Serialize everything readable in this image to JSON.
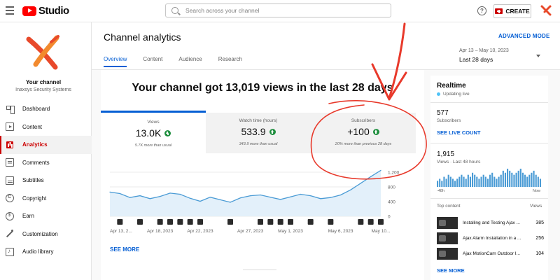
{
  "header": {
    "logo_text": "Studio",
    "search_placeholder": "Search across your channel",
    "help_icon": "?",
    "create_label": "CREATE"
  },
  "sidebar": {
    "channel_title": "Your channel",
    "channel_name": "Inaxsys Security Systems",
    "items": [
      {
        "label": "Dashboard",
        "icon": "dashboard-icon"
      },
      {
        "label": "Content",
        "icon": "content-icon"
      },
      {
        "label": "Analytics",
        "icon": "analytics-icon",
        "active": true
      },
      {
        "label": "Comments",
        "icon": "comments-icon"
      },
      {
        "label": "Subtitles",
        "icon": "subtitles-icon"
      },
      {
        "label": "Copyright",
        "icon": "copyright-icon"
      },
      {
        "label": "Earn",
        "icon": "earn-icon"
      },
      {
        "label": "Customization",
        "icon": "customization-icon"
      },
      {
        "label": "Audio library",
        "icon": "audio-library-icon"
      }
    ]
  },
  "page": {
    "title": "Channel analytics",
    "advanced_mode": "ADVANCED MODE",
    "tabs": [
      "Overview",
      "Content",
      "Audience",
      "Research"
    ],
    "active_tab": "Overview",
    "date_range": "Apr 13 – May 10, 2023",
    "date_period": "Last 28 days"
  },
  "summary": {
    "headline": "Your channel got 13,019 views in the last 28 days",
    "metrics": [
      {
        "label": "Views",
        "value": "13.0K",
        "note": "5.7K more than usual"
      },
      {
        "label": "Watch time (hours)",
        "value": "533.9",
        "note": "343.9 more than usual"
      },
      {
        "label": "Subscribers",
        "value": "+100",
        "note": "20% more than previous 28 days"
      }
    ],
    "see_more": "SEE MORE"
  },
  "chart_data": {
    "type": "area",
    "series": [
      {
        "values": [
          660,
          620,
          510,
          560,
          480,
          540,
          630,
          600,
          490,
          410,
          520,
          450,
          380,
          500,
          560,
          580,
          520,
          460,
          530,
          600,
          560,
          480,
          510,
          580,
          720,
          900,
          1080,
          1250
        ]
      }
    ],
    "x_ticks": [
      "Apr 13, 2...",
      "Apr 18, 2023",
      "Apr 22, 2023",
      "Apr 27, 2023",
      "May 1, 2023",
      "May 6, 2023",
      "May 10..."
    ],
    "y_ticks": [
      "1,200",
      "800",
      "400",
      "0"
    ],
    "ylim": [
      0,
      1200
    ],
    "grid": true,
    "color": "#4a9bd5"
  },
  "realtime": {
    "title": "Realtime",
    "updating": "Updating live",
    "subscribers": "577",
    "subscribers_label": "Subscribers",
    "see_live_count": "SEE LIVE COUNT",
    "views": "1,915",
    "views_label": "Views · Last 48 hours",
    "bars": [
      3,
      4,
      3,
      5,
      4,
      6,
      5,
      4,
      3,
      4,
      5,
      6,
      5,
      4,
      6,
      5,
      7,
      6,
      5,
      4,
      5,
      6,
      5,
      4,
      6,
      7,
      5,
      4,
      5,
      6,
      8,
      7,
      9,
      8,
      7,
      6,
      7,
      8,
      9,
      7,
      6,
      5,
      6,
      7,
      8,
      6,
      5,
      4
    ],
    "axis_left": "-48h",
    "axis_right": "Now",
    "top_content_label": "Top content",
    "views_col_label": "Views",
    "top_content": [
      {
        "title": "Installing and Testing Ajax ...",
        "views": "385"
      },
      {
        "title": "Ajax Alarm Installation in a ...",
        "views": "256"
      },
      {
        "title": "Ajax MotionCam Outdoor I...",
        "views": "104"
      }
    ],
    "see_more": "SEE MORE"
  },
  "colors": {
    "accent": "#065fd4",
    "brand": "#ff0000",
    "annotation": "#e8392b",
    "up": "#1e8e3e"
  }
}
